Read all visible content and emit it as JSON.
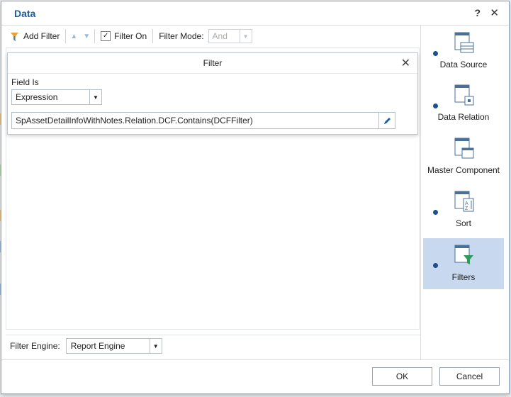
{
  "dialog": {
    "title": "Data",
    "help_label": "?",
    "close_label": "✕"
  },
  "toolbar": {
    "add_filter_label": "Add Filter",
    "filter_on_label": "Filter On",
    "filter_on_checked": true,
    "filter_mode_label": "Filter Mode:",
    "filter_mode_value": "And"
  },
  "filter_panel": {
    "title": "Filter",
    "field_is_label": "Field Is",
    "field_type_value": "Expression",
    "expression_value": "SpAssetDetailInfoWithNotes.Relation.DCF.Contains(DCFFilter)"
  },
  "filter_engine": {
    "label": "Filter Engine:",
    "value": "Report Engine"
  },
  "nav": {
    "items": [
      {
        "label": "Data Source",
        "has_dot": true,
        "active": false
      },
      {
        "label": "Data Relation",
        "has_dot": true,
        "active": false
      },
      {
        "label": "Master Component",
        "has_dot": false,
        "active": false
      },
      {
        "label": "Sort",
        "has_dot": true,
        "active": false
      },
      {
        "label": "Filters",
        "has_dot": true,
        "active": true
      }
    ]
  },
  "footer": {
    "ok_label": "OK",
    "cancel_label": "Cancel"
  },
  "colors": {
    "accent": "#1f5f9e",
    "active_nav": "#c7d8ef"
  }
}
